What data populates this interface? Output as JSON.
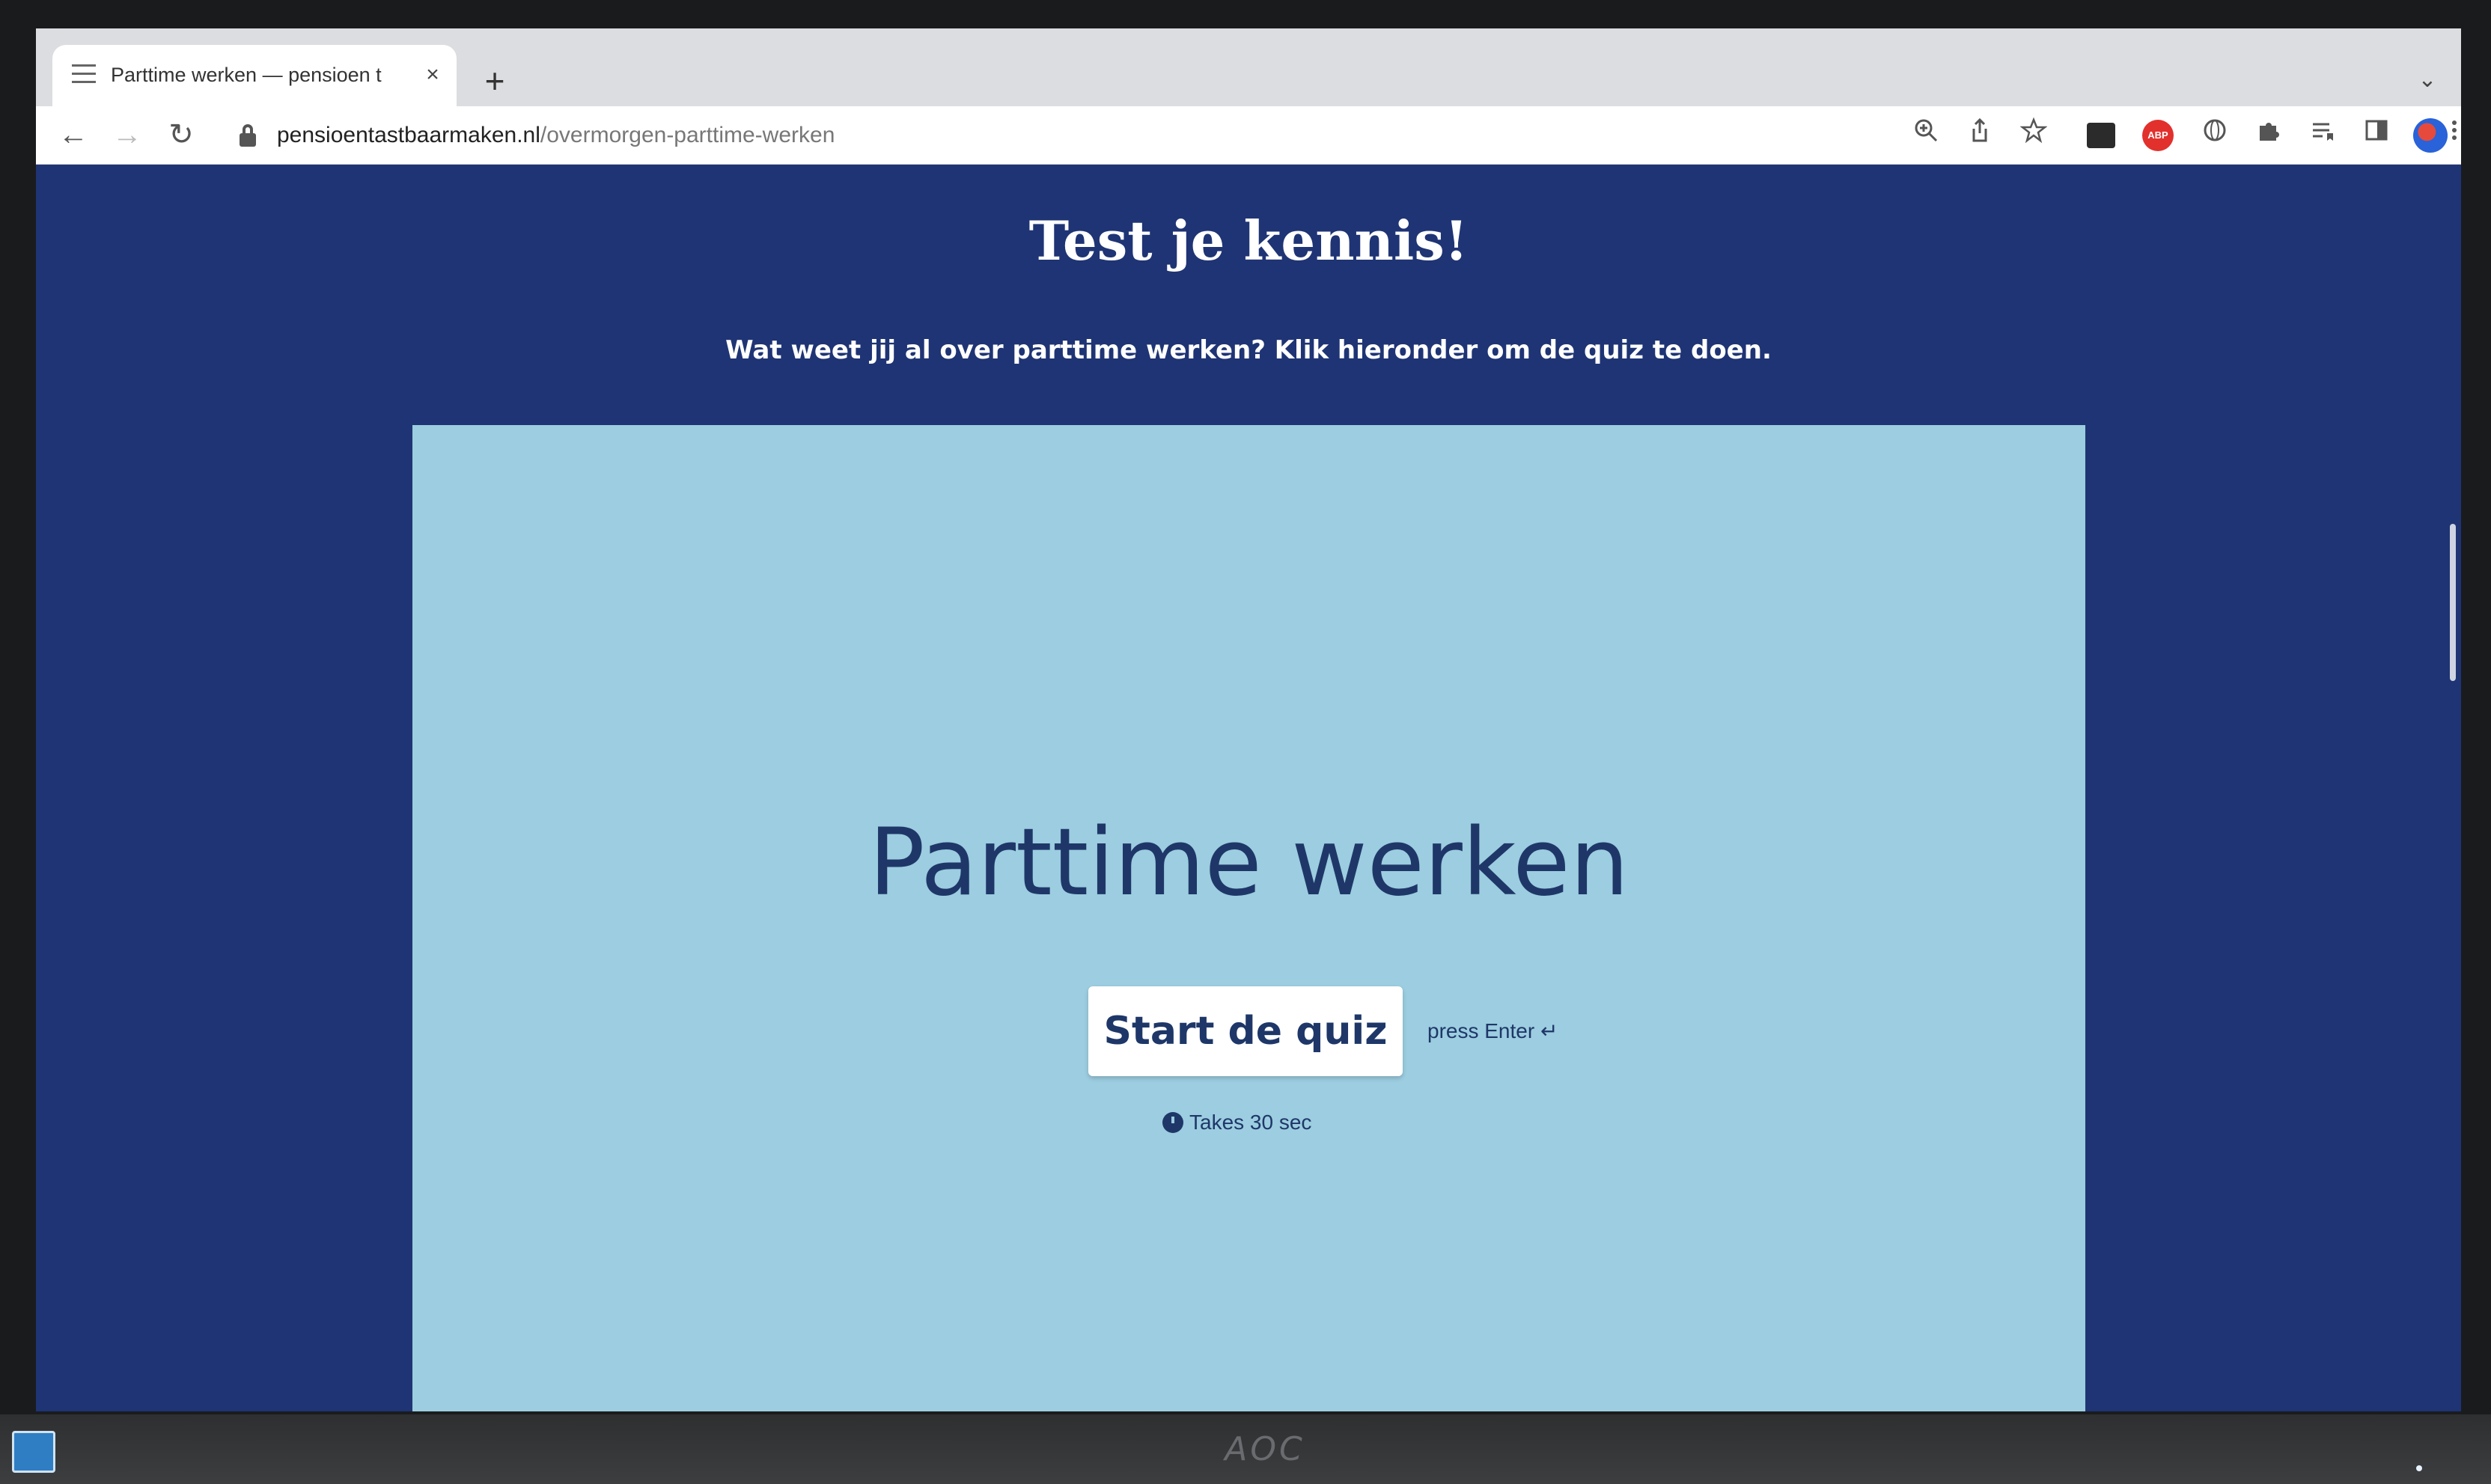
{
  "browser": {
    "tab_title": "Parttime werken — pensioen t",
    "close_tab_glyph": "×",
    "new_tab_glyph": "+",
    "tab_list_glyph": "⌄",
    "url_domain": "pensioentastbaarmaken.nl",
    "url_path": "/overmorgen-parttime-werken",
    "nav": {
      "back": "←",
      "forward": "→",
      "reload": "↻"
    },
    "toolbar_icons": [
      "zoom-icon",
      "share-icon",
      "bookmark-star-icon",
      "extension-dark-icon",
      "adblock-icon",
      "extension-globe-icon",
      "extensions-puzzle-icon",
      "reading-list-icon",
      "side-panel-icon",
      "profile-avatar",
      "more-menu-icon"
    ],
    "adblock_label": "ABP"
  },
  "page": {
    "heading": "Test je kennis!",
    "subtitle": "Wat weet jij al over parttime werken? Klik hieronder om de quiz te doen."
  },
  "quiz": {
    "title": "Parttime werken",
    "start_label": "Start de quiz",
    "press_enter": "press Enter ↵",
    "duration": "Takes 30 sec",
    "panel_color": "#9ccde0",
    "text_color": "#1e3768"
  },
  "monitor": {
    "brand": "AOC"
  },
  "colors": {
    "page_background": "#1f3474",
    "heading": "#ffffff"
  }
}
